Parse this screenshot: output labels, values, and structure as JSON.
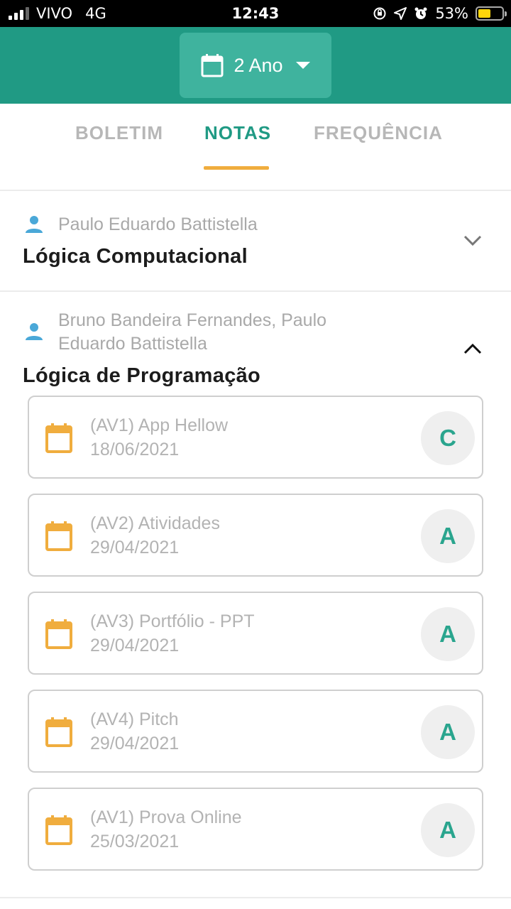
{
  "status_bar": {
    "carrier": "VIVO",
    "network": "4G",
    "time": "12:43",
    "battery_percent": "53%",
    "battery_level": 0.53
  },
  "header": {
    "year_label": "2 Ano",
    "colors": {
      "primary": "#209a84",
      "selector_bg": "#3fb39e",
      "accent": "#f0ad3e"
    }
  },
  "tabs": [
    {
      "label": "BOLETIM",
      "active": false
    },
    {
      "label": "NOTAS",
      "active": true
    },
    {
      "label": "FREQUÊNCIA",
      "active": false
    }
  ],
  "subjects": [
    {
      "teacher": "Paulo Eduardo Battistella",
      "title": "Lógica Computacional",
      "expanded": false,
      "icon": "chevron-down-icon"
    },
    {
      "teacher_line1": "Bruno Bandeira Fernandes, Paulo",
      "teacher_line2": "Eduardo Battistella",
      "title": "Lógica de Programação",
      "expanded": true,
      "icon": "chevron-up-icon",
      "assessments": [
        {
          "title": "(AV1) App Hellow",
          "date": "18/06/2021",
          "grade": "C"
        },
        {
          "title": "(AV2) Atividades",
          "date": "29/04/2021",
          "grade": "A"
        },
        {
          "title": "(AV3) Portfólio - PPT",
          "date": "29/04/2021",
          "grade": "A"
        },
        {
          "title": "(AV4) Pitch",
          "date": "29/04/2021",
          "grade": "A"
        },
        {
          "title": "(AV1) Prova Online",
          "date": "25/03/2021",
          "grade": "A"
        }
      ]
    }
  ]
}
